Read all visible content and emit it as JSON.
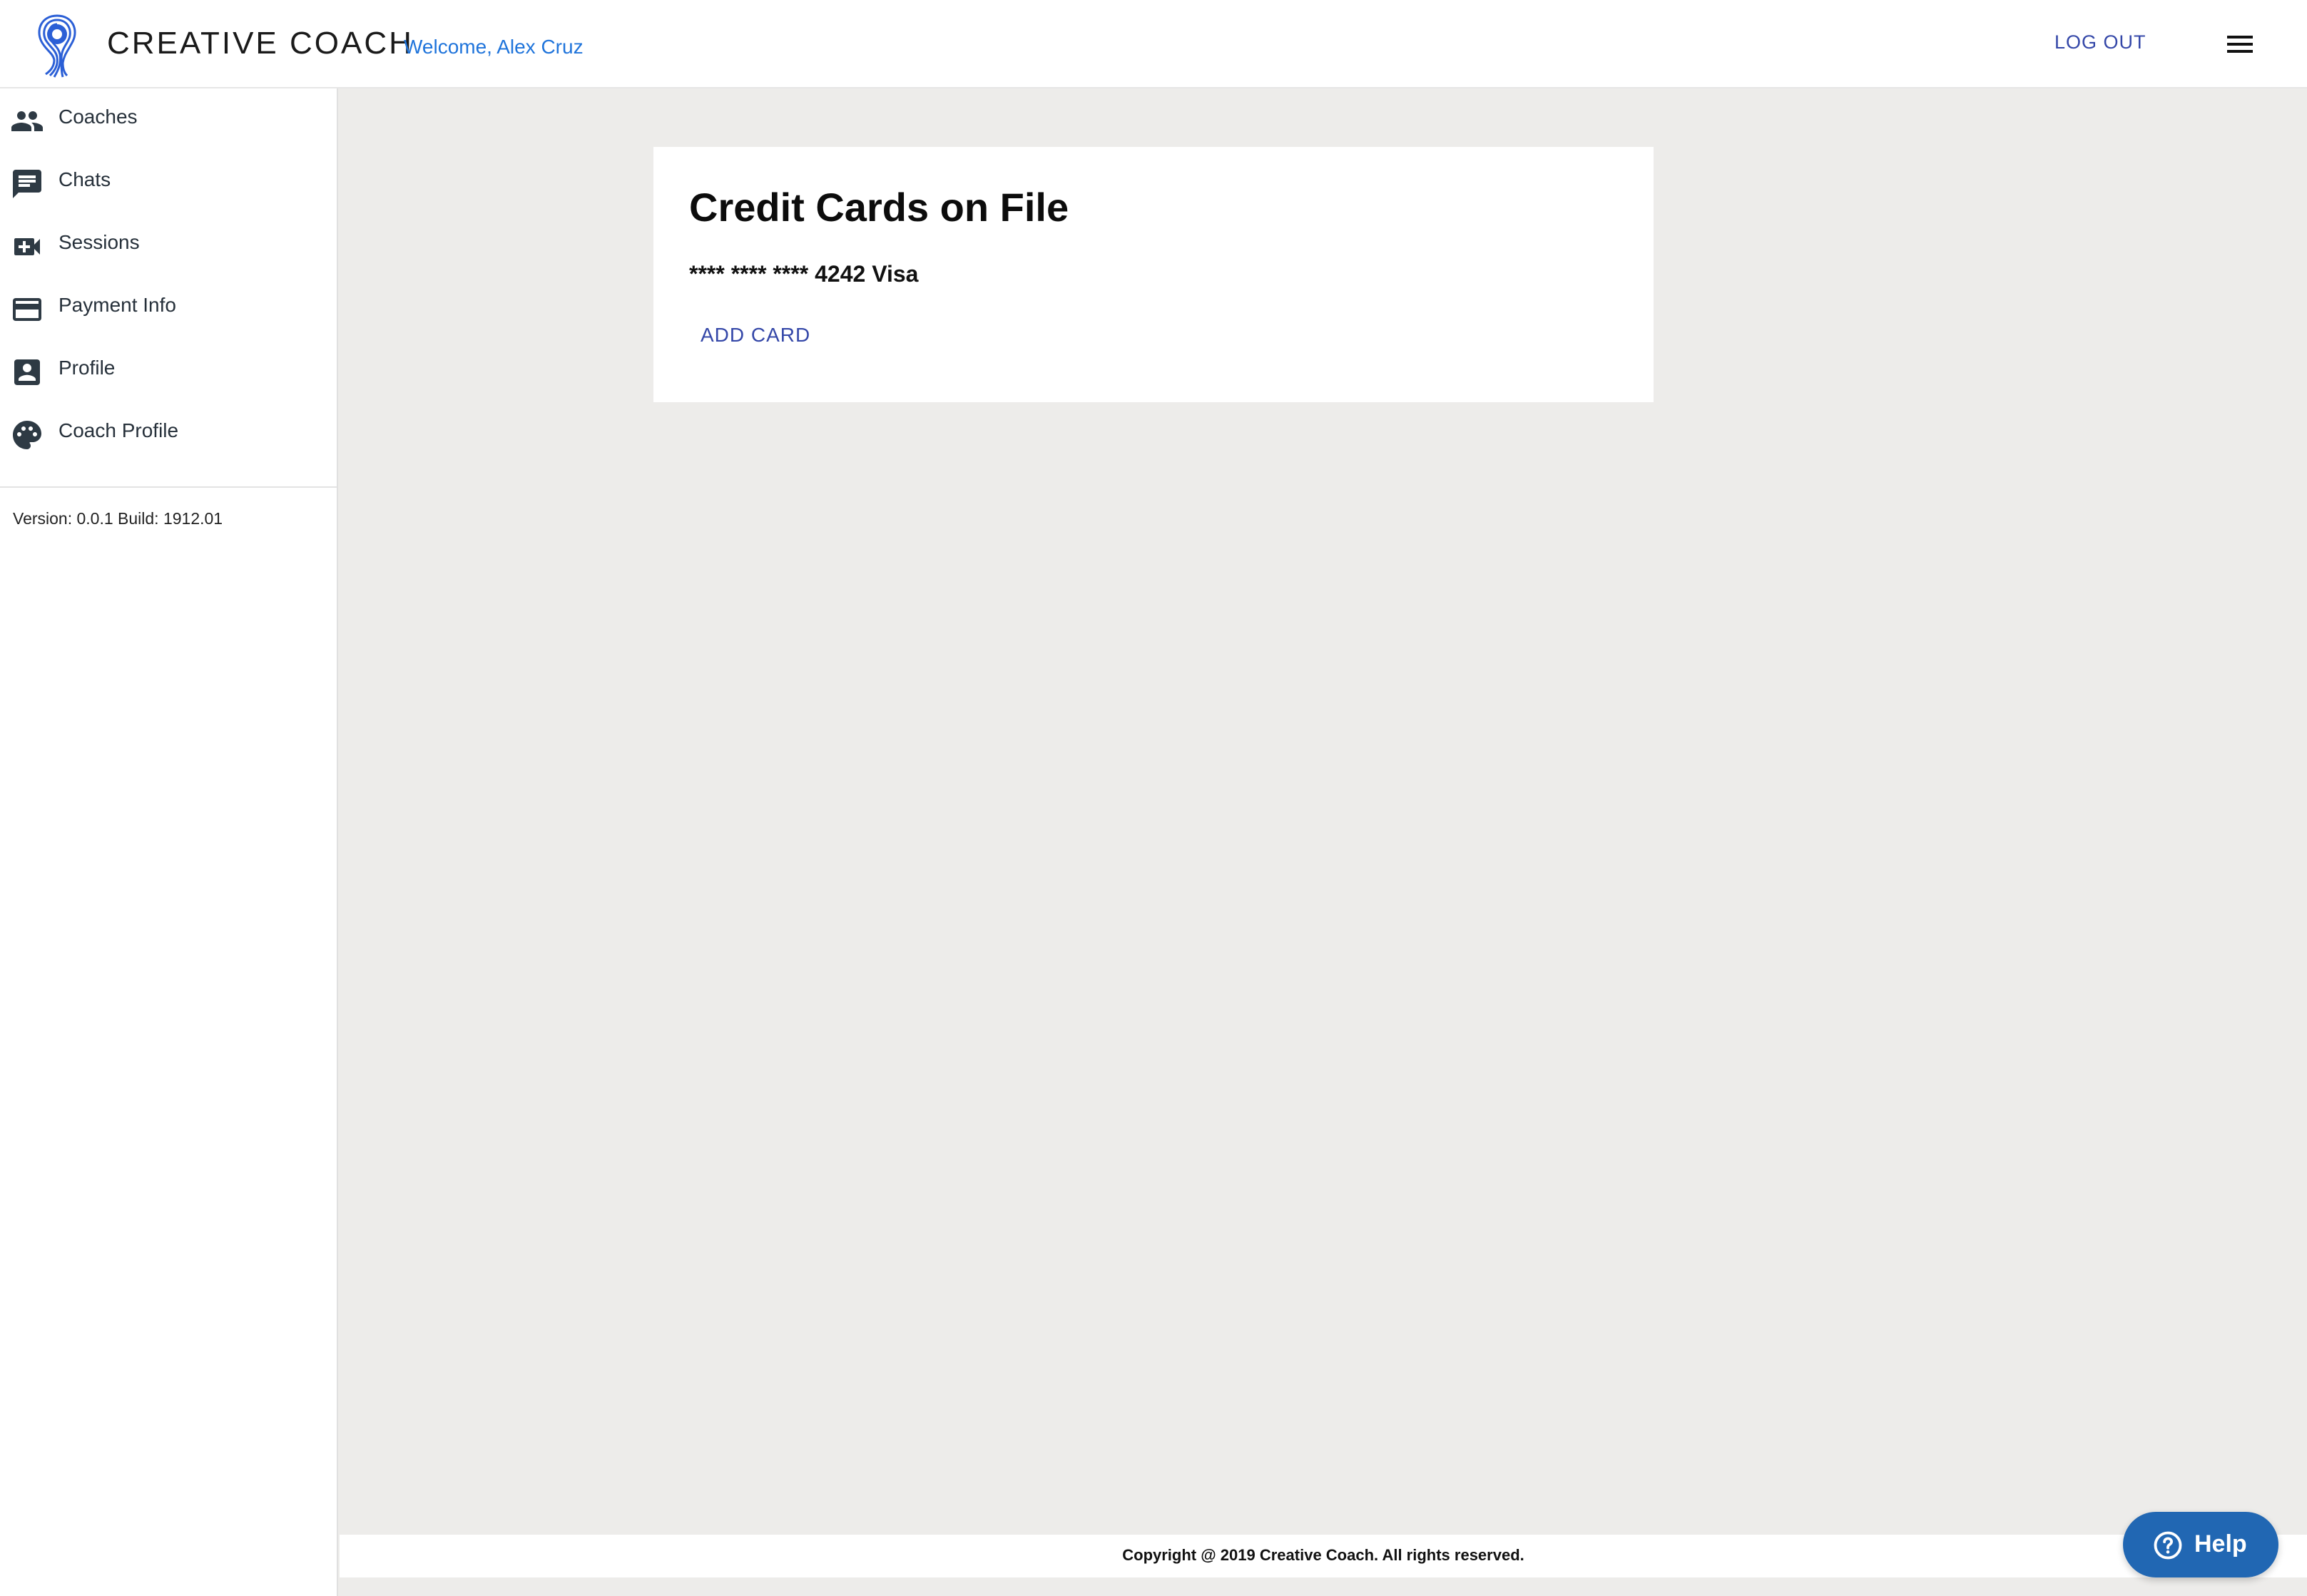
{
  "header": {
    "brand": "CREATIVE COACH",
    "welcome": "Welcome, Alex Cruz",
    "logout_label": "LOG OUT",
    "logo_icon": "coach-logo-icon",
    "menu_icon": "hamburger-menu-icon"
  },
  "sidebar": {
    "items": [
      {
        "label": "Coaches",
        "icon": "people-icon"
      },
      {
        "label": "Chats",
        "icon": "chat-icon"
      },
      {
        "label": "Sessions",
        "icon": "video-add-icon"
      },
      {
        "label": "Payment Info",
        "icon": "credit-card-icon"
      },
      {
        "label": "Profile",
        "icon": "contact-card-icon"
      },
      {
        "label": "Coach Profile",
        "icon": "palette-icon"
      }
    ],
    "version": "Version: 0.0.1 Build: 1912.01"
  },
  "card": {
    "title": "Credit Cards on File",
    "card_line": "**** **** **** 4242 Visa",
    "add_card_label": "ADD CARD"
  },
  "footer": {
    "copyright": "Copyright @ 2019 Creative Coach. All rights reserved."
  },
  "help": {
    "label": "Help",
    "icon": "question-circle-icon"
  },
  "colors": {
    "background": "#edecea",
    "accent_link": "#3447a8",
    "welcome_blue": "#1f74db",
    "help_button": "#2167b3",
    "sidebar_text": "#26303a"
  }
}
